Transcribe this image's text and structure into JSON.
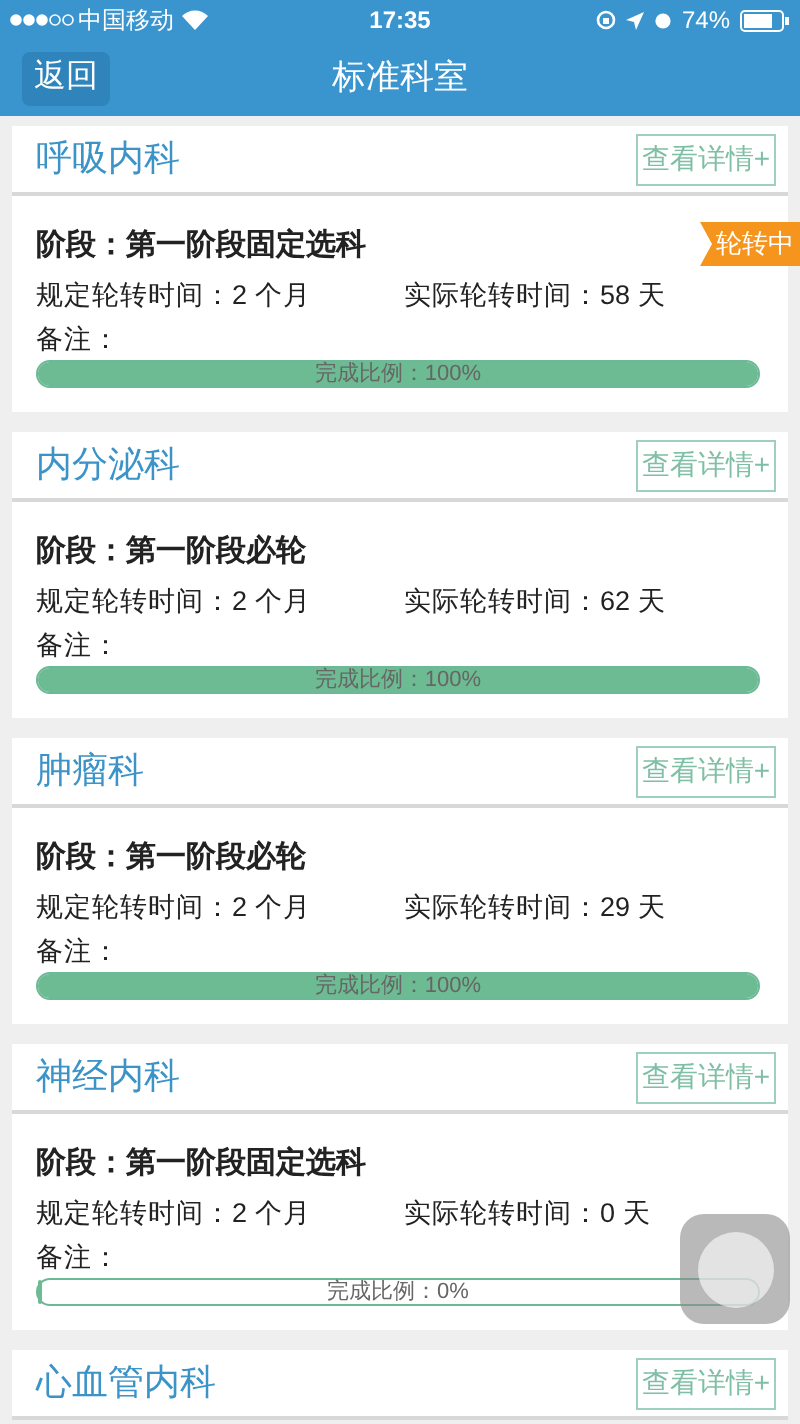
{
  "status_bar": {
    "carrier": "中国移动",
    "time": "17:35",
    "battery": "74%"
  },
  "nav": {
    "back": "返回",
    "title": "标准科室"
  },
  "cards": [
    {
      "title": "呼吸内科",
      "action": "查看详情+",
      "badge": "轮转中",
      "stage": "阶段：第一阶段固定选科",
      "planned": "规定轮转时间：2 个月",
      "actual": "实际轮转时间：58 天",
      "remark": "备注：",
      "progress": {
        "label": "完成比例：100%",
        "level": 1
      }
    },
    {
      "title": "内分泌科",
      "action": "查看详情+",
      "stage": "阶段：第一阶段必轮",
      "planned": "规定轮转时间：2 个月",
      "actual": "实际轮转时间：62 天",
      "remark": "备注：",
      "progress": {
        "label": "完成比例：100%",
        "level": 1
      }
    },
    {
      "title": "肿瘤科",
      "action": "查看详情+",
      "stage": "阶段：第一阶段必轮",
      "planned": "规定轮转时间：2 个月",
      "actual": "实际轮转时间：29 天",
      "remark": "备注：",
      "progress": {
        "label": "完成比例：100%",
        "level": 1
      }
    },
    {
      "title": "神经内科",
      "action": "查看详情+",
      "stage": "阶段：第一阶段固定选科",
      "planned": "规定轮转时间：2 个月",
      "actual": "实际轮转时间：0 天",
      "remark": "备注：",
      "progress": {
        "label": "完成比例：0%",
        "level": 0
      }
    },
    {
      "title": "心血管内科",
      "action": "查看详情+"
    }
  ]
}
